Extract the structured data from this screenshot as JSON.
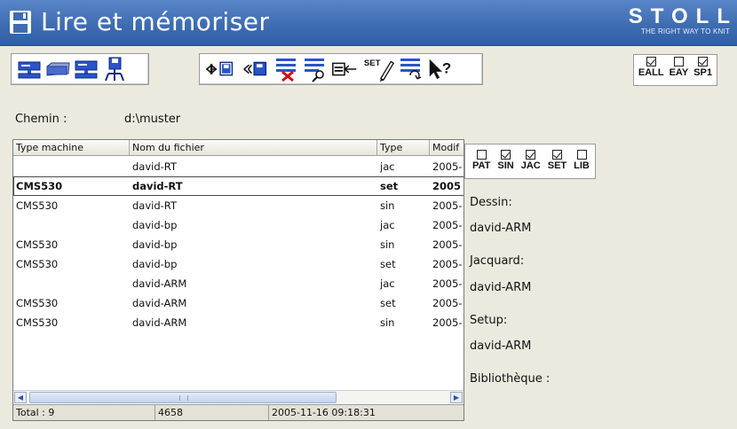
{
  "window": {
    "title": "Lire et mémoriser",
    "brand": "STOLL",
    "brand_tagline": "THE RIGHT WAY TO KNIT"
  },
  "toolbar": {
    "drive_buttons": [
      "machine-icon",
      "disk-drive-icon",
      "network-machine-icon",
      "network-save-icon"
    ],
    "action_buttons": [
      "transfer-icon",
      "copy-icon",
      "delete-file-icon",
      "find-file-icon",
      "send-to-icon",
      "set-edit-icon",
      "convert-icon",
      "help-cursor-icon"
    ],
    "flags": [
      {
        "label": "EALL",
        "checked": true
      },
      {
        "label": "EAY",
        "checked": false
      },
      {
        "label": "SP1",
        "checked": true
      }
    ]
  },
  "path": {
    "label": "Chemin :",
    "value": "d:\\muster"
  },
  "table": {
    "columns": [
      "Type machine",
      "Nom du fichier",
      "Type",
      "Modif"
    ],
    "rows": [
      {
        "machine": "",
        "name": "david-RT",
        "type": "jac",
        "date": "2005-",
        "selected": false
      },
      {
        "machine": "CMS530",
        "name": "david-RT",
        "type": "set",
        "date": "2005",
        "selected": true
      },
      {
        "machine": "CMS530",
        "name": "david-RT",
        "type": "sin",
        "date": "2005-",
        "selected": false
      },
      {
        "machine": "",
        "name": "david-bp",
        "type": "jac",
        "date": "2005-",
        "selected": false
      },
      {
        "machine": "CMS530",
        "name": "david-bp",
        "type": "sin",
        "date": "2005-",
        "selected": false
      },
      {
        "machine": "CMS530",
        "name": "david-bp",
        "type": "set",
        "date": "2005-",
        "selected": false
      },
      {
        "machine": "",
        "name": "david-ARM",
        "type": "jac",
        "date": "2005-",
        "selected": false
      },
      {
        "machine": "CMS530",
        "name": "david-ARM",
        "type": "set",
        "date": "2005-",
        "selected": false
      },
      {
        "machine": "CMS530",
        "name": "david-ARM",
        "type": "sin",
        "date": "2005-",
        "selected": false
      }
    ]
  },
  "status": {
    "total": "Total : 9",
    "size": "4658",
    "date": "2005-11-16 09:18:31"
  },
  "type_filter": [
    {
      "label": "PAT",
      "checked": false
    },
    {
      "label": "SIN",
      "checked": true
    },
    {
      "label": "JAC",
      "checked": true
    },
    {
      "label": "SET",
      "checked": true
    },
    {
      "label": "LIB",
      "checked": false
    }
  ],
  "info": {
    "dessin_label": "Dessin:",
    "dessin_value": "david-ARM",
    "jacquard_label": "Jacquard:",
    "jacquard_value": "david-ARM",
    "setup_label": "Setup:",
    "setup_value": "david-ARM",
    "bibliotheque_label": "Bibliothèque :"
  },
  "colors": {
    "title_bar": "#3e6db2",
    "background": "#eceadf",
    "accent_blue": "#1f4fb4"
  }
}
